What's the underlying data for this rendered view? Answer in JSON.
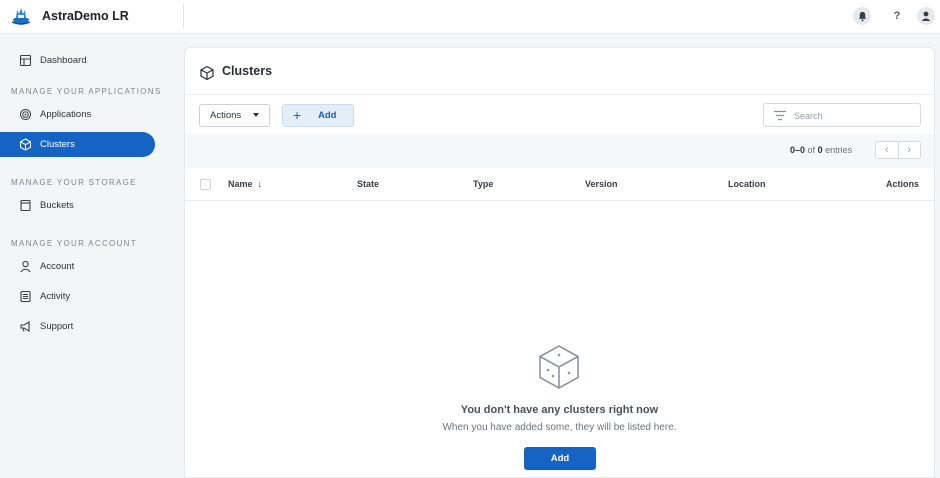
{
  "app": {
    "name": "AstraDemo LR"
  },
  "header": {
    "icons": [
      "bell-icon",
      "help-icon",
      "user-icon"
    ],
    "help_glyph": "?"
  },
  "sidebar": {
    "top_items": [
      {
        "label": "Dashboard",
        "icon": "dashboard-icon"
      }
    ],
    "sections": [
      {
        "title": "MANAGE YOUR APPLICATIONS",
        "items": [
          {
            "label": "Applications",
            "icon": "applications-icon"
          },
          {
            "label": "Clusters",
            "icon": "cube-icon",
            "active": true
          }
        ]
      },
      {
        "title": "MANAGE YOUR STORAGE",
        "items": [
          {
            "label": "Buckets",
            "icon": "bucket-icon"
          }
        ]
      },
      {
        "title": "MANAGE YOUR ACCOUNT",
        "items": [
          {
            "label": "Account",
            "icon": "person-icon"
          },
          {
            "label": "Activity",
            "icon": "activity-icon"
          },
          {
            "label": "Support",
            "icon": "megaphone-icon"
          }
        ]
      }
    ]
  },
  "page": {
    "title": "Clusters",
    "toolbar": {
      "actions_label": "Actions",
      "add_label": "Add",
      "search_placeholder": "Search",
      "search_value": ""
    },
    "pagination": {
      "range": "0–0",
      "of_text": "of",
      "total": "0",
      "suffix": "entries"
    },
    "table": {
      "columns": [
        "Name",
        "State",
        "Type",
        "Version",
        "Location",
        "Actions"
      ],
      "sort_indicator": "↓",
      "rows": []
    },
    "empty_state": {
      "title": "You don't have any clusters right now",
      "subtitle": "When you have added some, they will be listed here.",
      "button_label": "Add"
    }
  },
  "colors": {
    "accent": "#1563c3",
    "accent_light": "#e3eef9",
    "sidebar_bg": "#f4f5f7"
  }
}
